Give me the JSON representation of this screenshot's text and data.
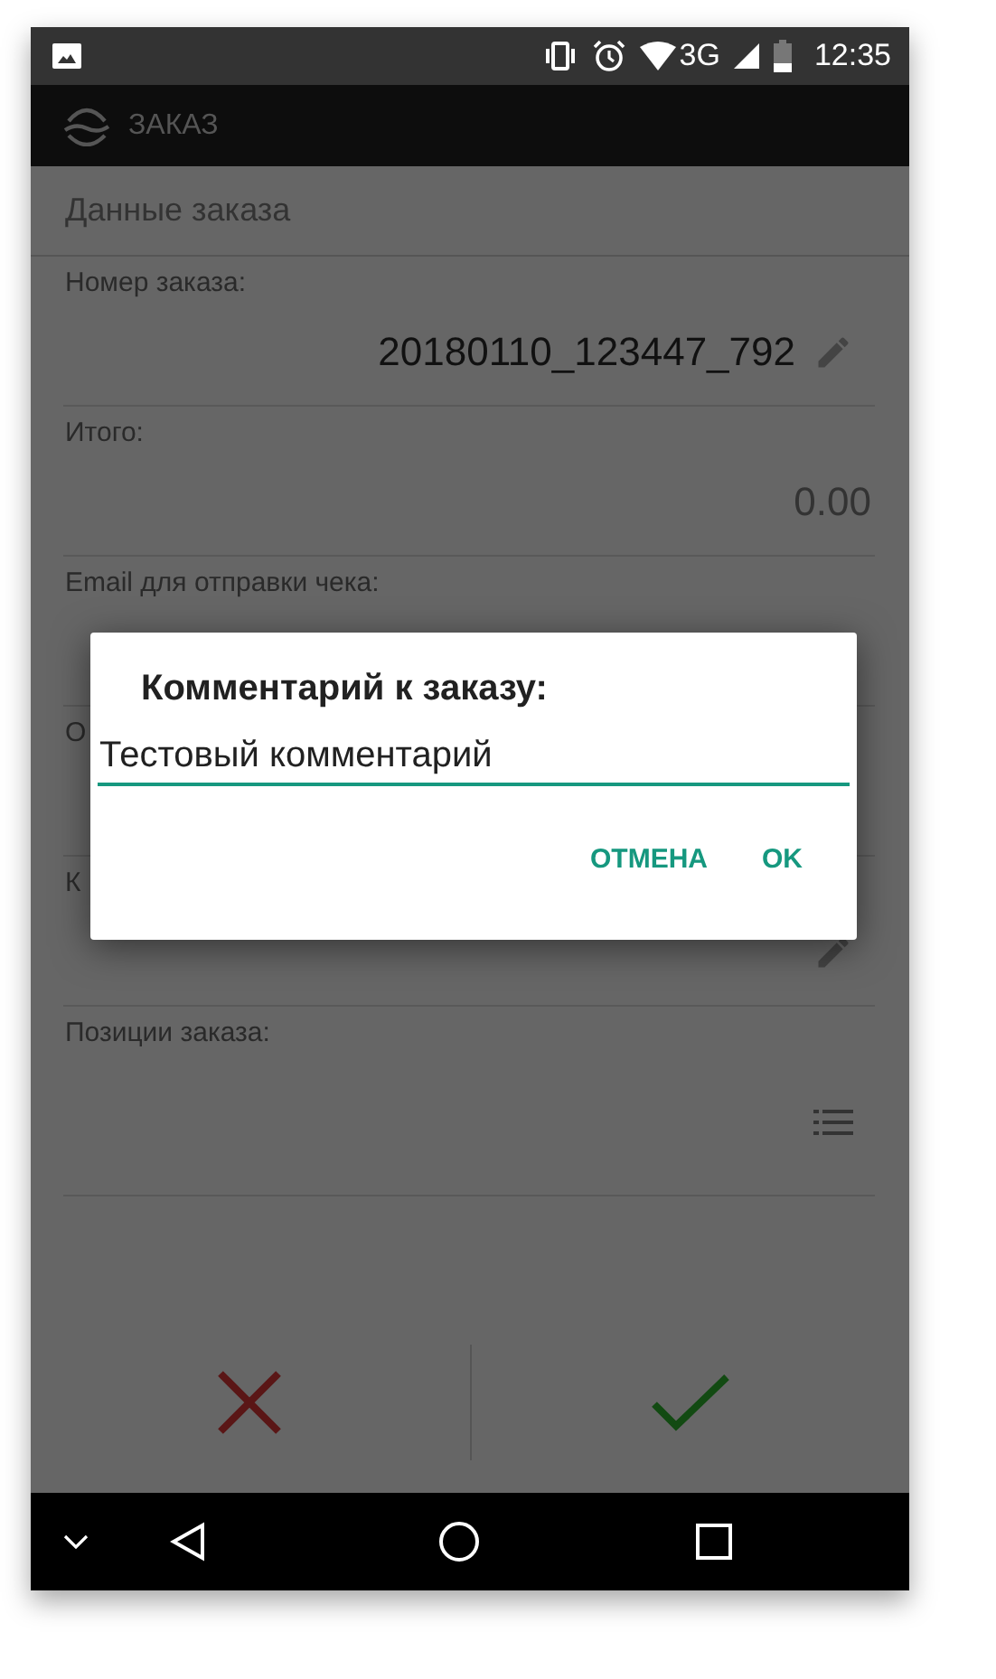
{
  "status_bar": {
    "time": "12:35",
    "network": "3G"
  },
  "app_bar": {
    "title": "ЗАКАЗ"
  },
  "section": {
    "title": "Данные заказа"
  },
  "fields": [
    {
      "label": "Номер заказа:",
      "value": "20180110_123447_792",
      "kind": "edit",
      "emphasis": true
    },
    {
      "label": "Итого:",
      "value": "0.00",
      "emphasis": false
    },
    {
      "label": "Email для отправки чека:"
    },
    {
      "label": "О"
    },
    {
      "label": "К",
      "kind": "edit"
    },
    {
      "label": "Позиции заказа:",
      "kind": "list",
      "tall": true
    }
  ],
  "actions": [
    {
      "kind": "cancel"
    },
    {
      "kind": "confirm"
    }
  ],
  "dialog": {
    "title": "Комментарий к заказу:",
    "value": "Тестовый комментарий",
    "focused": true,
    "buttons": [
      "ОТМЕНА",
      "OK"
    ]
  }
}
